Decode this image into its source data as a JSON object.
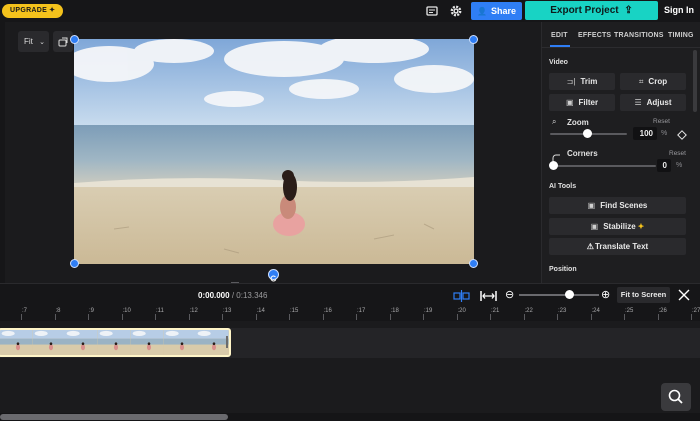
{
  "topbar": {
    "upgrade_label": "UPGRADE",
    "share_label": "Share",
    "export_label": "Export Project",
    "signin_label": "Sign In",
    "icons": [
      "subtitles-icon",
      "gear-icon",
      "user-plus-icon",
      "export-upload-icon"
    ]
  },
  "canvas": {
    "fit_label": "Fit",
    "icons": [
      "chevron-down-icon",
      "aspect-ratio-icon",
      "rotate-icon"
    ]
  },
  "panel": {
    "tabs": [
      "EDIT",
      "EFFECTS",
      "TRANSITIONS",
      "TIMING"
    ],
    "active_tab": "EDIT",
    "video_section": "Video",
    "buttons": {
      "trim": "Trim",
      "crop": "Crop",
      "filter": "Filter",
      "adjust": "Adjust"
    },
    "zoom": {
      "label": "Zoom",
      "reset": "Reset",
      "value": "100",
      "unit": "%",
      "level": 0.5
    },
    "corners": {
      "label": "Corners",
      "reset": "Reset",
      "value": "0",
      "unit": "%",
      "level": 0.0
    },
    "ai_section": "AI Tools",
    "ai_buttons": {
      "find_scenes": "Find Scenes",
      "stabilize": "Stabilize",
      "translate": "Translate Text"
    },
    "position_section": "Position"
  },
  "timeline": {
    "current_time": "0:00.000",
    "separator": "/",
    "total_time": "0:13.346",
    "fit_to_screen": "Fit to Screen",
    "zoom_level": 0.62,
    "ticks": [
      ":7",
      ":8",
      ":9",
      ":10",
      ":11",
      ":12",
      ":13",
      ":14",
      ":15",
      ":16",
      ":17",
      ":18",
      ":19",
      ":20",
      ":21",
      ":22",
      ":23",
      ":24",
      ":25",
      ":26",
      ":27"
    ],
    "clip_frames": 7
  },
  "colors": {
    "accent_blue": "#2f7ef5",
    "export_teal": "#18d3c4",
    "upgrade_yellow": "#f4c21c",
    "panel_bg": "#1e1e20"
  }
}
